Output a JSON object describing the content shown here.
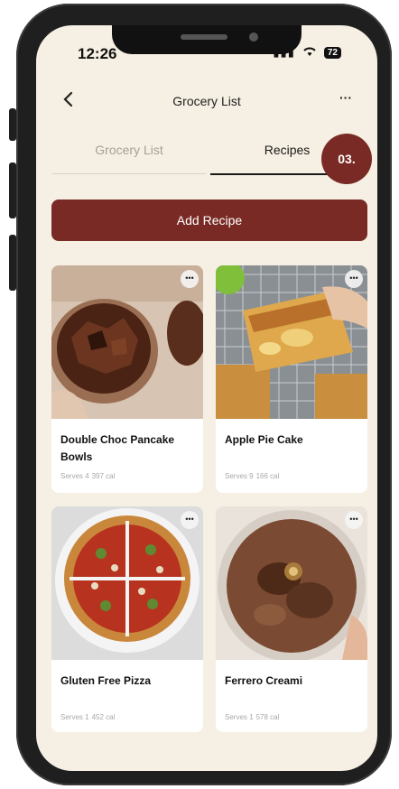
{
  "status": {
    "time": "12:26",
    "battery": "72"
  },
  "nav": {
    "back_icon": "chevron-left-icon",
    "title": "Grocery List",
    "more_label": "···"
  },
  "tabs": [
    {
      "label": "Grocery List",
      "active": false
    },
    {
      "label": "Recipes",
      "active": true
    }
  ],
  "step_badge": "03.",
  "add_button_label": "Add Recipe",
  "more_glyph": "•••",
  "recipes": [
    {
      "title": "Double Choc Pancake Bowls",
      "serves": "Serves 4",
      "calories": "397 cal"
    },
    {
      "title": "Apple Pie Cake",
      "serves": "Serves 9",
      "calories": "166 cal"
    },
    {
      "title": "Gluten Free Pizza",
      "serves": "Serves 1",
      "calories": "452 cal"
    },
    {
      "title": "Ferrero Creami",
      "serves": "Serves 1",
      "calories": "578 cal"
    }
  ],
  "colors": {
    "accent": "#7a2a24",
    "background": "#f6efe3",
    "card": "#ffffff",
    "frame": "#1f1f1f"
  }
}
